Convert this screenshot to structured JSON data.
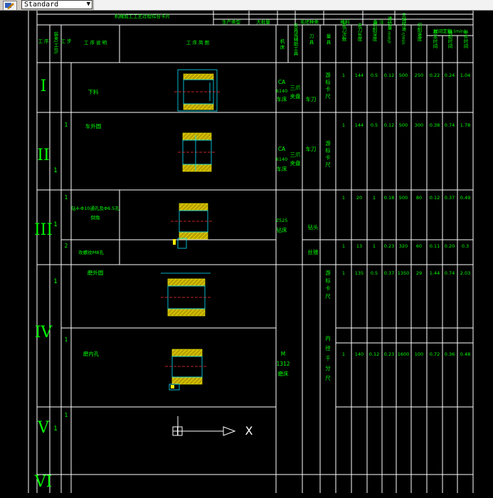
{
  "toolbar": {
    "text_style": "Standard",
    "style_icon": "text-style-icon",
    "dropdown_icon": "chevron-down-icon"
  },
  "header": {
    "card_title": "机械加工工艺过程综合卡片",
    "top_labels": [
      "生产类型",
      "大批量",
      "毛坯种类",
      "棒料",
      "备 注"
    ],
    "tools_group": "刀 具",
    "cutting_group": "时间定额 (min)"
  },
  "columns": {
    "process_no": "工 序",
    "install": "装夹(工位)",
    "step": "工 步",
    "content": "工 序 说 明",
    "sketch": "工 序 简 图",
    "machine": "机 床",
    "fixture": "夹具或辅助工具",
    "tool": "刀 具",
    "gauge": "量 具",
    "passes": "走刀次数",
    "allowance": "走刀长度",
    "depth": "切削深度",
    "feed": "进给量 mm/r",
    "speed": "主轴转速 r/min",
    "cut_speed": "切削速度",
    "t_basic": "基本时间",
    "t_aux": "辅助时间",
    "t_unit": "单件时间"
  },
  "rows": [
    {
      "numeral": "I",
      "install": "",
      "step": "",
      "content": "下料",
      "machine": [
        "CA",
        "6140",
        "车床"
      ],
      "fixture": [
        "三爪",
        "夹盘"
      ],
      "tool": "车刀",
      "gauge": [
        "游",
        "标",
        "卡",
        "尺"
      ],
      "values": [
        "1",
        "144",
        "0.5",
        "0.12",
        "500",
        "250",
        "0.22",
        "0.24",
        "1.04"
      ]
    },
    {
      "numeral": "II",
      "install": "1",
      "step": "1",
      "content": "车外圆",
      "machine": [
        "CA",
        "6140",
        "车床"
      ],
      "fixture": [
        "三爪",
        "夹盘"
      ],
      "tool": "车刀",
      "gauge": [
        "游",
        "标",
        "卡",
        "尺"
      ],
      "values": [
        "1",
        "144",
        "0.5",
        "0.12",
        "500",
        "300",
        "0.38",
        "0.74",
        "1.78"
      ]
    },
    {
      "numeral": "III",
      "install": "1",
      "step": "1",
      "content": "钻4-Φ10通孔及Φ6.5孔",
      "content2": "倒角",
      "machine": [
        "Z525",
        "钻床"
      ],
      "tool": "钻头",
      "values": [
        "1",
        "20",
        "1",
        "0.18",
        "500",
        "80",
        "0.12",
        "0.37",
        "0.49"
      ]
    },
    {
      "numeral": "",
      "step": "2",
      "content": "攻螺纹M8孔",
      "tool": "丝锥",
      "values": [
        "1",
        "13",
        "1",
        "0.23",
        "320",
        "60",
        "0.11",
        "0.20",
        "0.3"
      ]
    },
    {
      "numeral": "IV",
      "install": "1",
      "step": "1",
      "content": "磨外圆",
      "gauge": [
        "游",
        "标",
        "卡",
        "尺"
      ],
      "values": [
        "1",
        "135",
        "0.5",
        "0.37",
        "1350",
        "29",
        "1.44",
        "0.74",
        "2.03"
      ]
    },
    {
      "numeral": "",
      "step": "1",
      "content": "磨内孔",
      "machine": [
        "M",
        "1312",
        "磨床"
      ],
      "gauge": [
        "内",
        "径",
        "千",
        "分",
        "尺"
      ],
      "values": [
        "1",
        "140",
        "0.12",
        "0.23",
        "1600",
        "100",
        "0.72",
        "0.36",
        "0.48"
      ]
    },
    {
      "numeral": "V",
      "install": "1",
      "step": "1",
      "content": ""
    },
    {
      "numeral": "VI",
      "install": "",
      "step": "",
      "content": ""
    }
  ],
  "ucs": {
    "x_label": "X",
    "icon": "ucs-axis-icon"
  },
  "colors": {
    "background": "#000000",
    "lines": "#ffffff",
    "text": "#00ff00",
    "hatch": "#e0e000",
    "sketch": "#00e5ff",
    "center_line": "#ff3030"
  }
}
